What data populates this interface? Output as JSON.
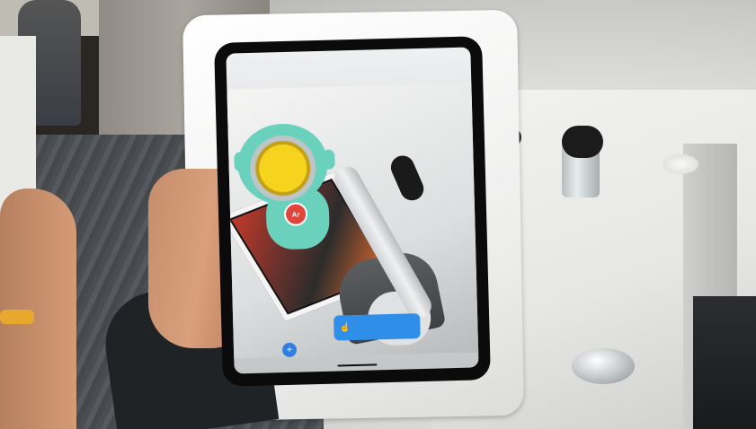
{
  "scene": {
    "description_free": true,
    "colors": {
      "case": "#f2f2f1",
      "screen_bezel": "#0b0b0c",
      "ar_character": "#6ad1bd",
      "ar_character_visor": "#f6d31d",
      "hint_pill": "#2f8fe8",
      "wristband": "#e8a82d"
    }
  },
  "tablet_screen": {
    "ar_badge_label": "Ar",
    "icons": {
      "fab": "plus-icon",
      "hint": "hand-tap-icon"
    }
  }
}
